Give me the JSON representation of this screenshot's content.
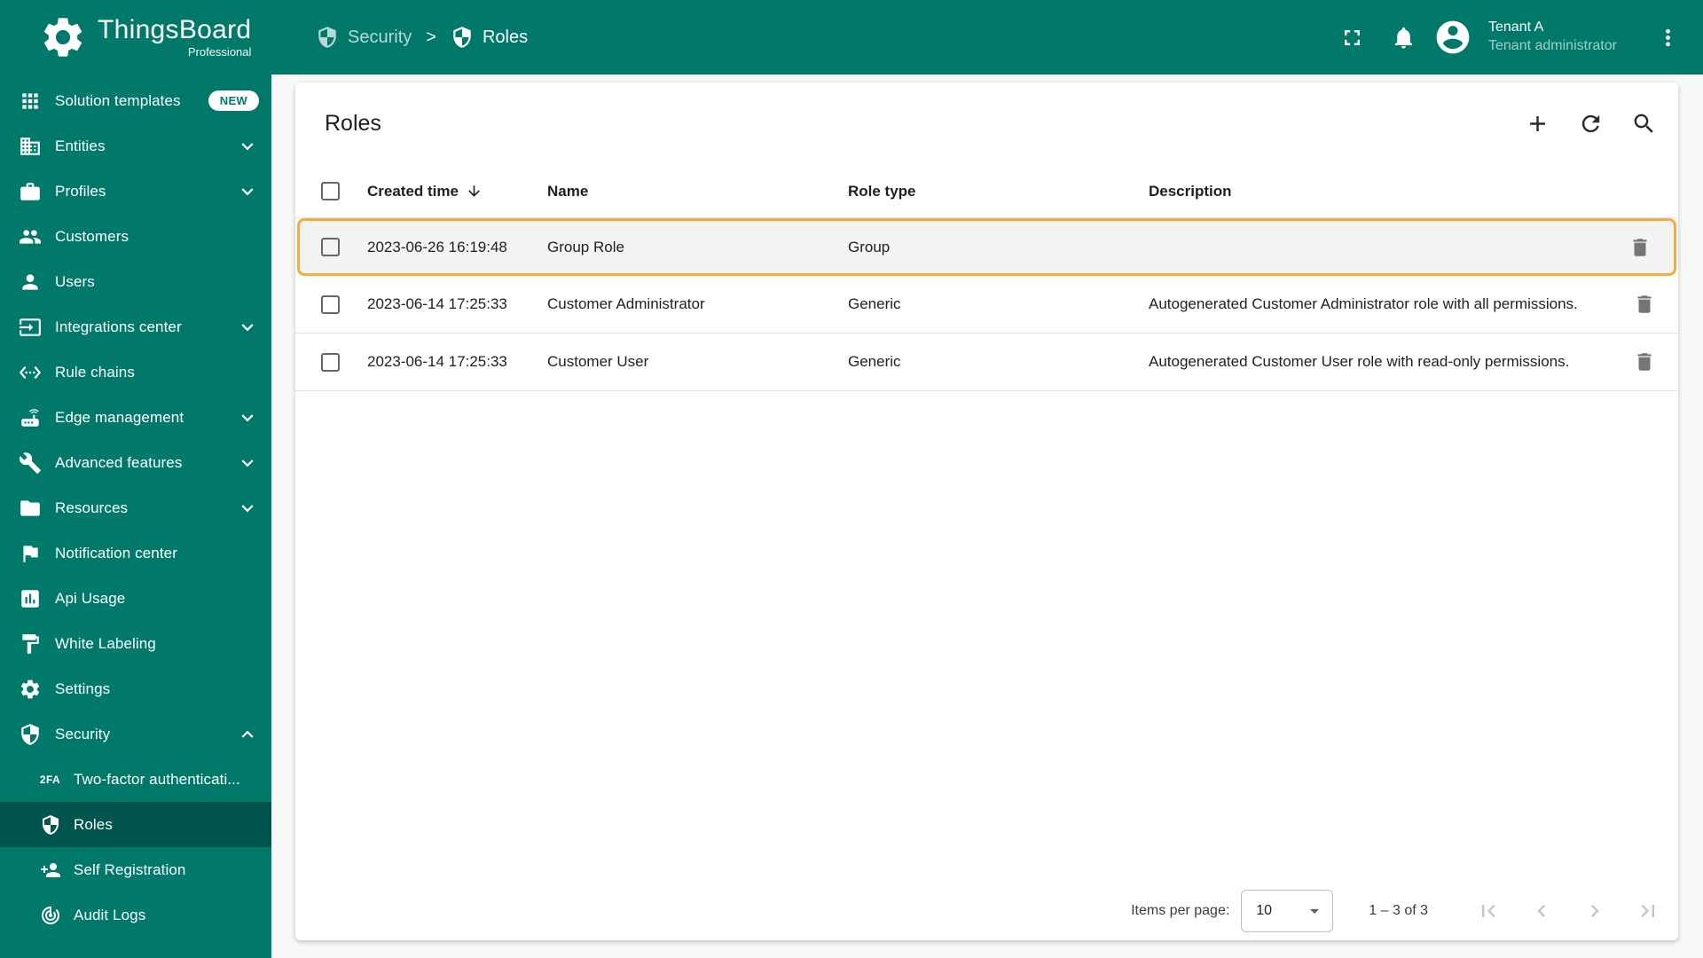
{
  "app": {
    "name": "ThingsBoard",
    "edition": "Professional"
  },
  "header": {
    "breadcrumb": [
      {
        "label": "Security",
        "icon": "shield-icon"
      },
      {
        "label": "Roles",
        "icon": "shield-icon"
      }
    ],
    "breadcrumb_separator": ">",
    "icons": {
      "fullscreen": "fullscreen-icon",
      "notifications": "bell-icon",
      "menu": "more-vert-icon",
      "avatar": "account-circle-icon"
    },
    "user": {
      "name": "Tenant A",
      "role": "Tenant administrator"
    }
  },
  "sidebar": {
    "items": [
      {
        "label": "Solution templates",
        "icon": "apps-grid-icon",
        "badge": "NEW"
      },
      {
        "label": "Entities",
        "icon": "building-icon",
        "expandable": true
      },
      {
        "label": "Profiles",
        "icon": "briefcase-icon",
        "expandable": true
      },
      {
        "label": "Customers",
        "icon": "people-icon"
      },
      {
        "label": "Users",
        "icon": "person-icon"
      },
      {
        "label": "Integrations center",
        "icon": "input-icon",
        "expandable": true
      },
      {
        "label": "Rule chains",
        "icon": "code-brackets-icon"
      },
      {
        "label": "Edge management",
        "icon": "router-icon",
        "expandable": true
      },
      {
        "label": "Advanced features",
        "icon": "wrench-icon",
        "expandable": true
      },
      {
        "label": "Resources",
        "icon": "folder-icon",
        "expandable": true
      },
      {
        "label": "Notification center",
        "icon": "flag-icon"
      },
      {
        "label": "Api Usage",
        "icon": "bar-chart-icon"
      },
      {
        "label": "White Labeling",
        "icon": "paint-icon"
      },
      {
        "label": "Settings",
        "icon": "gear-icon"
      },
      {
        "label": "Security",
        "icon": "shield-icon",
        "expanded": true
      }
    ],
    "security_children": [
      {
        "label": "Two-factor authenticati...",
        "icon": "2fa-icon",
        "glyph": "2FA"
      },
      {
        "label": "Roles",
        "icon": "shield-icon",
        "active": true
      },
      {
        "label": "Self Registration",
        "icon": "person-add-icon"
      },
      {
        "label": "Audit Logs",
        "icon": "track-changes-icon"
      }
    ]
  },
  "main": {
    "title": "Roles",
    "toolbar": {
      "add": "plus-icon",
      "refresh": "refresh-icon",
      "search": "search-icon"
    },
    "table": {
      "columns": {
        "created": "Created time",
        "name": "Name",
        "type": "Role type",
        "description": "Description"
      },
      "rows": [
        {
          "created": "2023-06-26 16:19:48",
          "name": "Group Role",
          "type": "Group",
          "description": "",
          "highlighted": true
        },
        {
          "created": "2023-06-14 17:25:33",
          "name": "Customer Administrator",
          "type": "Generic",
          "description": "Autogenerated Customer Administrator role with all permissions."
        },
        {
          "created": "2023-06-14 17:25:33",
          "name": "Customer User",
          "type": "Generic",
          "description": "Autogenerated Customer User role with read-only permissions."
        }
      ]
    },
    "pagination": {
      "items_per_page_label": "Items per page:",
      "page_size": "10",
      "range_label": "1 – 3 of 3"
    }
  },
  "colors": {
    "primary": "#00796b",
    "sidebar_active": "#00564c",
    "highlight_border": "#f2ae43"
  }
}
